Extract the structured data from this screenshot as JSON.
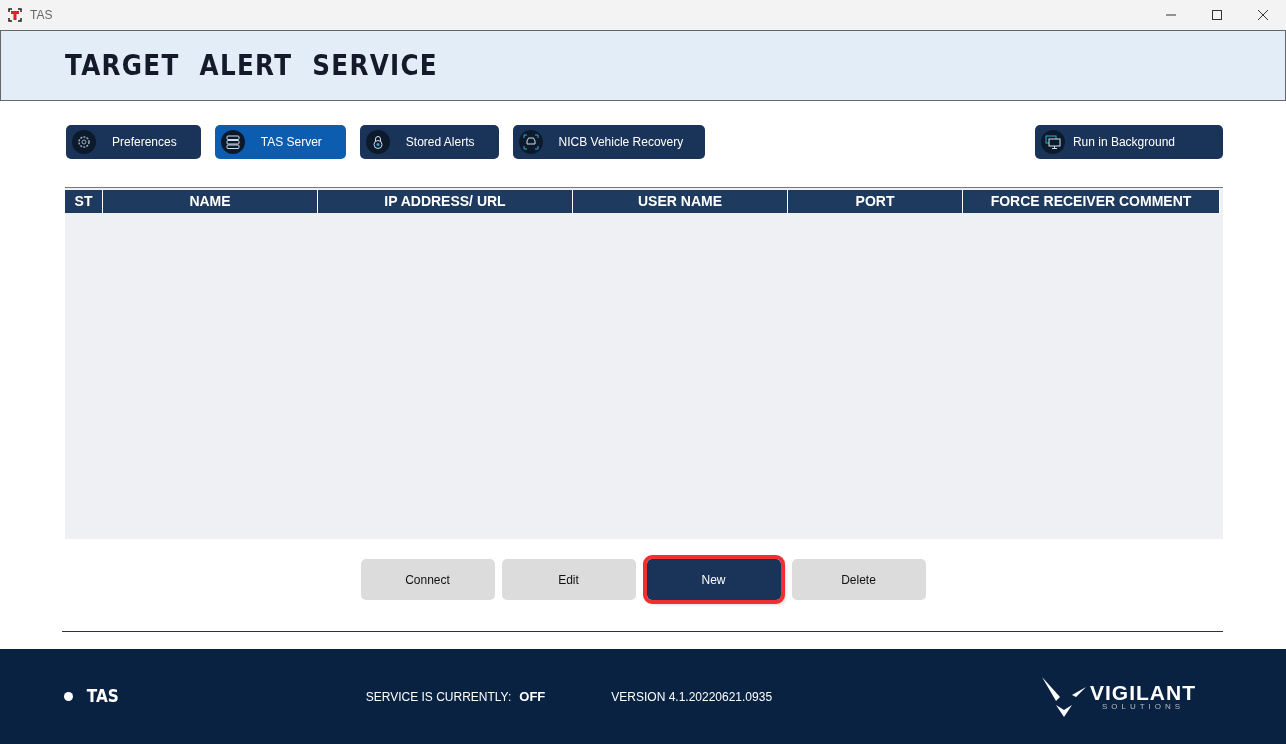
{
  "window": {
    "title": "TAS"
  },
  "header": {
    "title": "TARGET ALERT SERVICE"
  },
  "nav_buttons": [
    {
      "label": "Preferences",
      "selected": false
    },
    {
      "label": "TAS Server",
      "selected": true
    },
    {
      "label": "Stored Alerts",
      "selected": false
    },
    {
      "label": "NICB Vehicle Recovery",
      "selected": false
    }
  ],
  "background_button": {
    "label": "Run in Background"
  },
  "table": {
    "columns": [
      "ST",
      "NAME",
      "IP ADDRESS/ URL",
      "USER NAME",
      "PORT",
      "FORCE RECEIVER COMMENT"
    ]
  },
  "actions": [
    {
      "label": "Connect",
      "highlighted": false
    },
    {
      "label": "Edit",
      "highlighted": false
    },
    {
      "label": "New",
      "highlighted": true
    },
    {
      "label": "Delete",
      "highlighted": false
    }
  ],
  "footer": {
    "app": "TAS",
    "service_label": "SERVICE IS CURRENTLY:",
    "service_state": "OFF",
    "version": "VERSION 4.1.20220621.0935",
    "logo_name": "VIGILANT",
    "logo_sub": "SOLUTIONS"
  }
}
